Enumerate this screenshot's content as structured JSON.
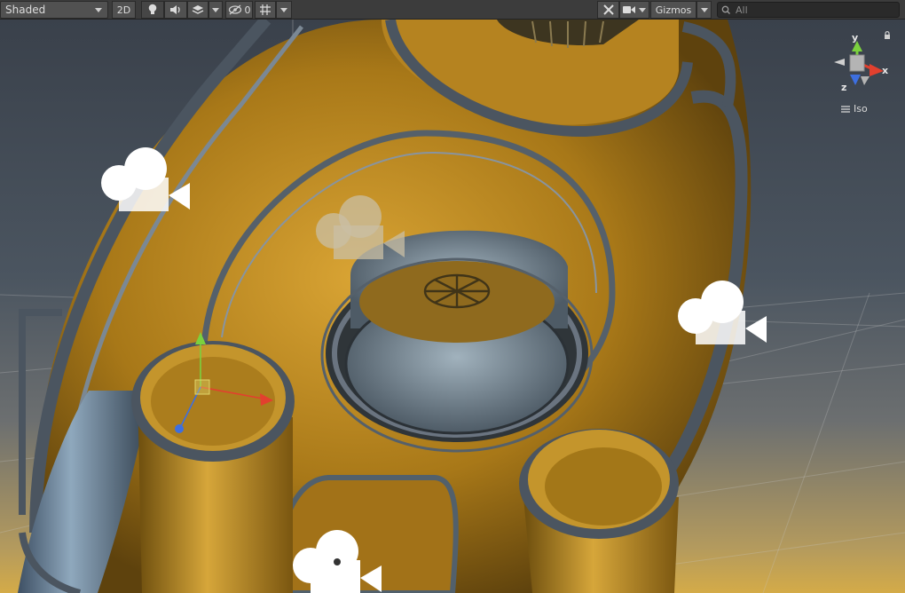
{
  "toolbar": {
    "draw_mode": "Shaded",
    "btn_2d": "2D",
    "hidden_count": "0",
    "gizmos": "Gizmos"
  },
  "search": {
    "placeholder": "All"
  },
  "scene_gizmo": {
    "axis_y": "y",
    "axis_x": "x",
    "axis_z": "z",
    "projection": "Iso"
  },
  "colors": {
    "axis_x": "#e2402e",
    "axis_y": "#7bd13e",
    "axis_z": "#3d6fe0",
    "hull": "#b5861e"
  }
}
